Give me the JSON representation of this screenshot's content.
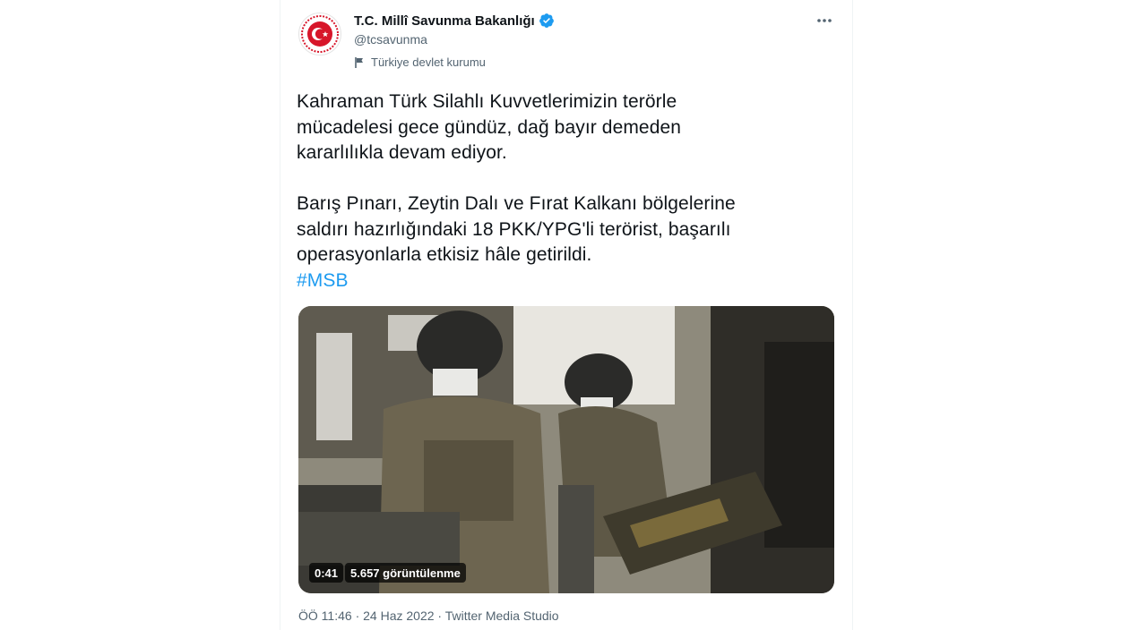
{
  "author": {
    "name": "T.C. Millî Savunma Bakanlığı",
    "handle": "@tcsavunma",
    "label": "Türkiye devlet kurumu"
  },
  "tweet": {
    "text": "Kahraman Türk Silahlı Kuvvetlerimizin terörle\nmücadelesi gece gündüz, dağ bayır demeden\nkararlılıkla devam ediyor.\n\nBarış Pınarı, Zeytin Dalı ve Fırat Kalkanı bölgelerine\nsaldırı hazırlığındaki 18 PKK/YPG'li terörist, başarılı\noperasyonlarla etkisiz hâle getirildi.",
    "hashtag": "#MSB"
  },
  "video": {
    "duration": "0:41",
    "views": "5.657 görüntülenme"
  },
  "meta": {
    "time": "ÖÖ 11:46",
    "separator": "·",
    "date": "24 Haz 2022",
    "source": "Twitter Media Studio"
  },
  "colors": {
    "accent": "#1d9bf0",
    "secondary_text": "#536471",
    "primary_text": "#0f1419",
    "logo_red": "#d7162a"
  },
  "icons": [
    "verified-icon",
    "more-options-icon",
    "flag-icon",
    "ministry-logo"
  ]
}
